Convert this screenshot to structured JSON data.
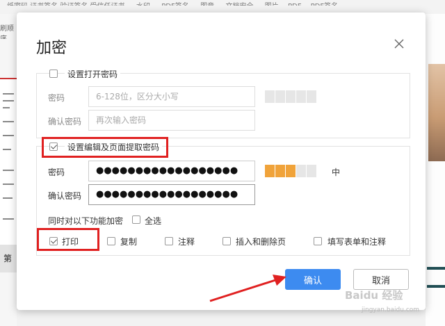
{
  "background": {
    "tabs_text": "…纸密码  证书签名  验证签名  受信任证书 … 水印 … PDF签名 … 图章 … 文档安全 … 图片… PDF… PDF签名",
    "left_label": "第",
    "left_strip_text": "刷顺序"
  },
  "dialog": {
    "title": "加密",
    "open_password": {
      "checkbox_label": "设置打开密码",
      "checked": false,
      "password_label": "密码",
      "password_placeholder": "6-128位，区分大小写",
      "confirm_label": "确认密码",
      "confirm_placeholder": "再次输入密码",
      "strength_segments": 5,
      "strength_filled": 0
    },
    "edit_password": {
      "checkbox_label": "设置编辑及页面提取密码",
      "checked": true,
      "password_label": "密码",
      "password_value": "●●●●●●●●●●●●●●●●●●",
      "confirm_label": "确认密码",
      "confirm_value": "●●●●●●●●●●●●●●●●●●",
      "strength_segments": 5,
      "strength_filled": 3,
      "strength_text": "中",
      "permissions_label": "同时对以下功能加密",
      "select_all_label": "全选",
      "permissions": [
        {
          "label": "打印",
          "checked": true
        },
        {
          "label": "复制",
          "checked": false
        },
        {
          "label": "注释",
          "checked": false
        },
        {
          "label": "插入和删除页",
          "checked": false
        },
        {
          "label": "填写表单和注释",
          "checked": false
        }
      ]
    },
    "confirm_button": "确认",
    "cancel_button": "取消"
  },
  "watermark": {
    "text": "Baidu 经验",
    "sub": "jingyan.baidu.com"
  },
  "colors": {
    "primary": "#3d8bf0",
    "strength_on": "#f0a33a",
    "annotation_red": "#e02020"
  }
}
